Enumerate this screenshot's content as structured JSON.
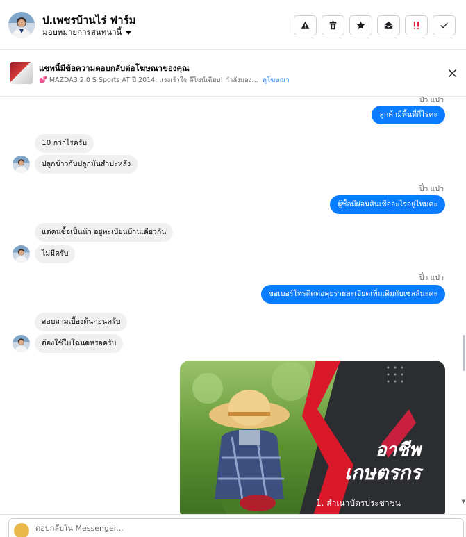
{
  "header": {
    "title": "ป.เพชรบ้านไร่ ฟาร์ม",
    "assign_label": "มอบหมายการสนทนานี้",
    "actions": [
      {
        "name": "spam-button",
        "icon": "warning-icon"
      },
      {
        "name": "delete-button",
        "icon": "trash-icon"
      },
      {
        "name": "star-button",
        "icon": "star-icon"
      },
      {
        "name": "mark-unread-button",
        "icon": "open-envelope-icon"
      },
      {
        "name": "important-button",
        "icon": "exclamation-icon",
        "color": "#e41e3f"
      },
      {
        "name": "done-button",
        "icon": "check-icon"
      }
    ]
  },
  "ad_banner": {
    "title": "แชทนี้มีข้อความตอบกลับต่อโฆษณาของคุณ",
    "ad_text": "💕 MAZDA3 2.0 S Sports AT ปี 2014: แรงเร้าใจ ดีไซน์เฉียบ! กำลังมอง…",
    "link": "ดูโฆษณา"
  },
  "messages": {
    "m1_sender": "ปิ๋ว แป่ว",
    "m1_text": "ลูกค้ามีพื้นที่กี่ไร่คะ",
    "m2_text": "10 กว่าไร่ครับ",
    "m3_text": "ปลูกข้าวกับปลูกมันสำปะหลัง",
    "m4_sender": "ปิ๋ว แป่ว",
    "m4_text": "ผู้ซื้อมีผ่อนสินเชื่ออะไรอยู่ไหมคะ",
    "m5_text": "แต่คนซื้อเป็นน้า อยู่ทะเบียนบ้านเดียวกัน",
    "m6_text": "ไม่มีครับ",
    "m7_sender": "ปิ๋ว แป่ว",
    "m7_text": "ขอเบอร์โทรติดต่อคุยรายละเอียดเพิ่มเติมกับเซลล์นะคะ",
    "m8_text": "สอบถามเบื้องต้นก่อนครับ",
    "m9_text": "ต้องใช้ใบโฉนดหรอครับ"
  },
  "image_message": {
    "title_line1": "อาชีพ",
    "title_line2": "เกษตรกร",
    "caption": "1. สำเนาบัตรประชาชน"
  },
  "composer": {
    "placeholder": "ตอบกลับใน Messenger..."
  },
  "colors": {
    "outgoing_bubble": "#0a7cff",
    "incoming_bubble": "#f0f0f0",
    "link": "#1877f2"
  }
}
